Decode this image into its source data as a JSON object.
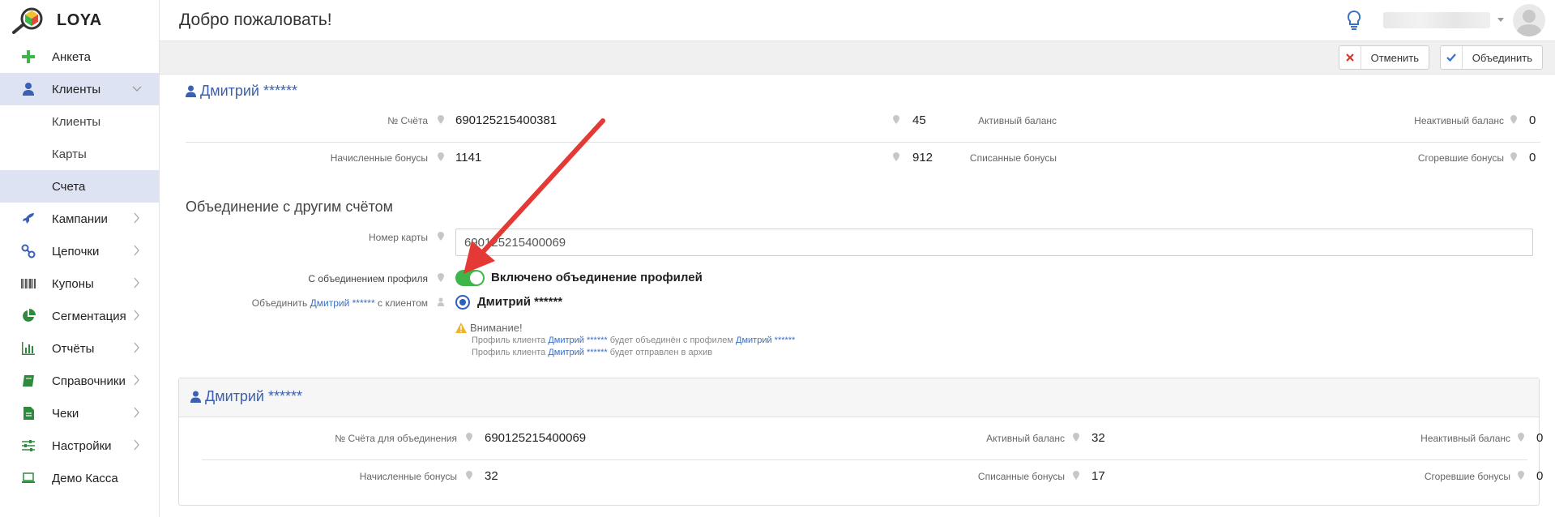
{
  "app": {
    "name": "LOYA"
  },
  "sidebar": {
    "items": [
      {
        "label": "Анкета",
        "icon": "plus-icon"
      },
      {
        "label": "Клиенты",
        "icon": "user-icon",
        "expanded": true,
        "children": [
          "Клиенты",
          "Карты",
          "Счета"
        ],
        "active_child": "Счета"
      },
      {
        "label": "Кампании",
        "icon": "rocket-icon"
      },
      {
        "label": "Цепочки",
        "icon": "chain-icon"
      },
      {
        "label": "Купоны",
        "icon": "barcode-icon"
      },
      {
        "label": "Сегментация",
        "icon": "pie-chart-icon"
      },
      {
        "label": "Отчёты",
        "icon": "bar-chart-icon"
      },
      {
        "label": "Справочники",
        "icon": "book-icon"
      },
      {
        "label": "Чеки",
        "icon": "receipt-icon"
      },
      {
        "label": "Настройки",
        "icon": "sliders-icon"
      },
      {
        "label": "Демо Касса",
        "icon": "laptop-icon"
      }
    ]
  },
  "header": {
    "title": "Добро пожаловать!"
  },
  "toolbar": {
    "cancel_label": "Отменить",
    "merge_label": "Объединить"
  },
  "source_account": {
    "client_name": "Дмитрий ******",
    "fields": [
      {
        "label": "№ Счёта",
        "value": "690125215400381"
      },
      {
        "label": "Активный баланс",
        "value": "45"
      },
      {
        "label": "Неактивный баланс",
        "value": "0"
      },
      {
        "label": "Начисленные бонусы",
        "value": "1141"
      },
      {
        "label": "Списанные бонусы",
        "value": "912"
      },
      {
        "label": "Сгоревшие бонусы",
        "value": "0"
      }
    ]
  },
  "merge_form": {
    "section_title": "Объединение с другим счётом",
    "card_number_label": "Номер карты",
    "card_number_value": "690125215400069",
    "profile_merge_label": "С объединением профиля",
    "profile_merge_text": "Включено объединение профилей",
    "profile_merge_enabled": true,
    "merge_with_prefix": "Объединить",
    "merge_with_name": "Дмитрий ******",
    "merge_with_suffix": "с клиентом",
    "radio_option": "Дмитрий ******",
    "warning_title": "Внимание!",
    "note1_prefix": "Профиль клиента",
    "note1_name1": "Дмитрий ******",
    "note1_middle": "будет объединён с профилем",
    "note1_name2": "Дмитрий ******",
    "note2_prefix": "Профиль клиента",
    "note2_name": "Дмитрий ******",
    "note2_suffix": "будет отправлен в архив"
  },
  "target_account": {
    "client_name": "Дмитрий ******",
    "fields": [
      {
        "label": "№ Счёта для объединения",
        "value": "690125215400069"
      },
      {
        "label": "Активный баланс",
        "value": "32"
      },
      {
        "label": "Неактивный баланс",
        "value": "0"
      },
      {
        "label": "Начисленные бонусы",
        "value": "32"
      },
      {
        "label": "Списанные бонусы",
        "value": "17"
      },
      {
        "label": "Сгоревшие бонусы",
        "value": "0"
      }
    ]
  },
  "colors": {
    "accent": "#3a5fb3",
    "toggle_on": "#3fb64a",
    "active_nav": "#dde3f2",
    "arrow": "#e53935"
  }
}
